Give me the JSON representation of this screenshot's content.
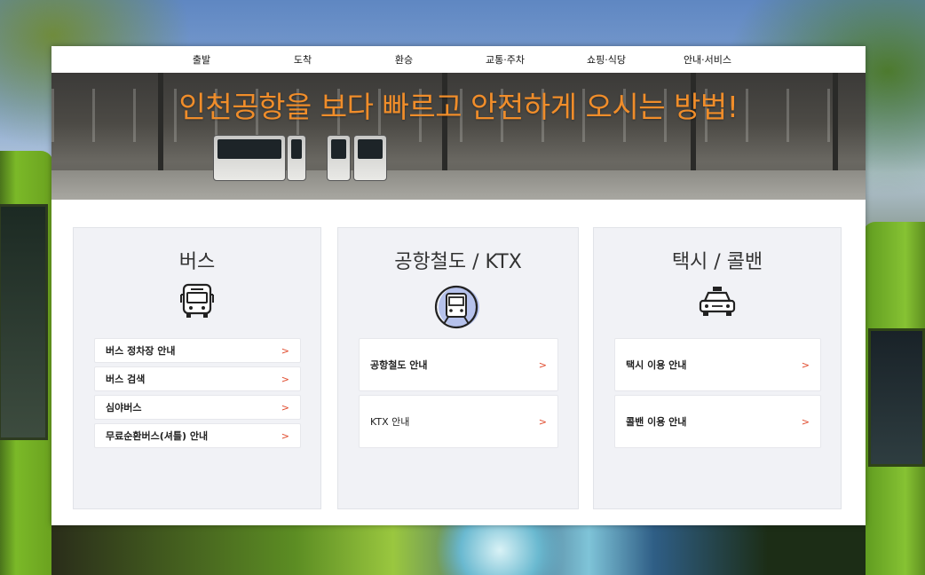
{
  "nav": {
    "items": [
      "출발",
      "도착",
      "환승",
      "교통·주차",
      "쇼핑·식당",
      "안내·서비스"
    ]
  },
  "hero": {
    "title": "인천공항을 보다 빠르고 안전하게 오시는 방법!"
  },
  "cards": {
    "bus": {
      "title": "버스",
      "icon": "bus-icon",
      "links": [
        "버스 정차장 안내",
        "버스 검색",
        "심야버스",
        "무료순환버스(셔틀) 안내"
      ]
    },
    "rail": {
      "title": "공항철도 / KTX",
      "icon": "train-icon",
      "links": [
        "공항철도 안내",
        "KTX 안내"
      ]
    },
    "taxi": {
      "title": "택시 / 콜밴",
      "icon": "taxi-icon",
      "links": [
        "택시 이용 안내",
        "콜밴 이용 안내"
      ]
    }
  },
  "arrow_glyph": ">",
  "colors": {
    "accent": "#f08d2a",
    "arrow": "#e04a2c",
    "card_bg": "#f1f2f6"
  }
}
